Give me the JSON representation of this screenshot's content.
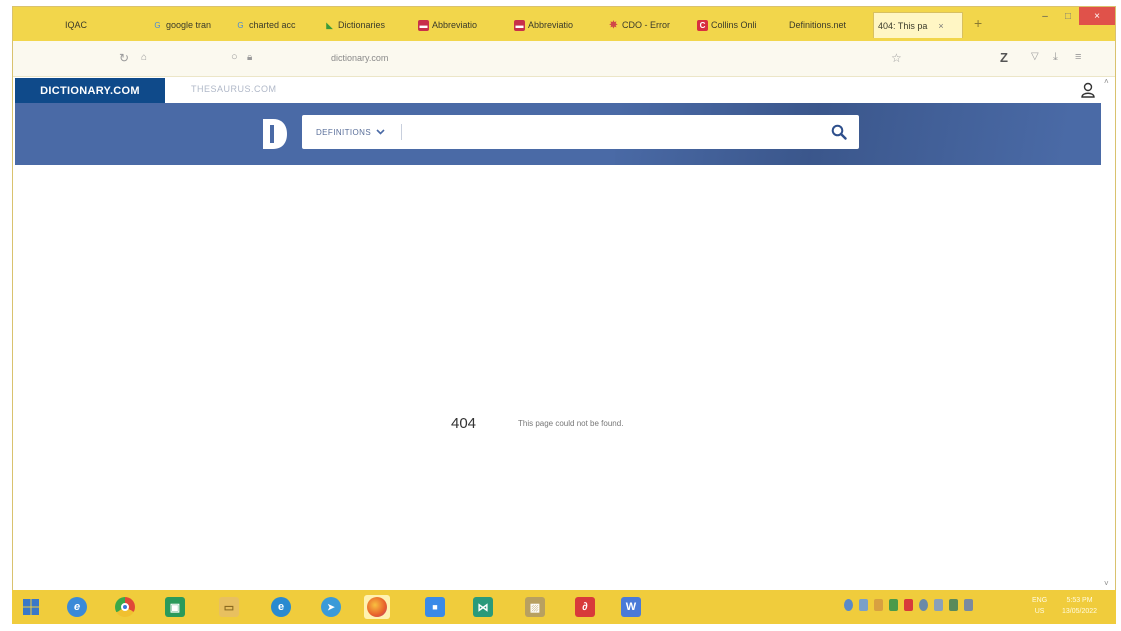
{
  "tabs": [
    {
      "label": "IQAC",
      "icon": "",
      "active": false
    },
    {
      "label": "google tran",
      "icon": "google-icon",
      "active": false
    },
    {
      "label": "charted acc",
      "icon": "google-icon",
      "active": false
    },
    {
      "label": "Dictionaries",
      "icon": "dictionaries-icon",
      "active": false
    },
    {
      "label": "Abbreviatio",
      "icon": "abbreviations-icon",
      "active": false
    },
    {
      "label": "Abbreviatio",
      "icon": "abbreviations-icon",
      "active": false
    },
    {
      "label": "CDO - Error",
      "icon": "cdo-icon",
      "active": false
    },
    {
      "label": "Collins Onli",
      "icon": "collins-icon",
      "active": false
    },
    {
      "label": "Definitions.net",
      "icon": "",
      "active": false
    },
    {
      "label": "404: This pa",
      "icon": "",
      "active": true
    }
  ],
  "tab_close": "×",
  "new_tab": "+",
  "window": {
    "minimize": "–",
    "maximize": "□",
    "close": "×"
  },
  "nav": {
    "url": "dictionary.com"
  },
  "toolbar": {
    "z_logo": "Z"
  },
  "site": {
    "dictionary_tab": "DICTIONARY.COM",
    "thesaurus_tab": "THESAURUS.COM",
    "search_mode": "DEFINITIONS",
    "search_placeholder": ""
  },
  "error": {
    "code": "404",
    "message": "This page could not be found."
  },
  "tray": {
    "lang": "ENG",
    "region": "US",
    "time": "5:53 PM",
    "date": "13/05/2022"
  },
  "colors": {
    "browser_chrome": "#f2d64b",
    "site_brand": "#0f4a8a",
    "site_bar": "#4a6aa6",
    "taskbar": "#f0cc3c"
  }
}
